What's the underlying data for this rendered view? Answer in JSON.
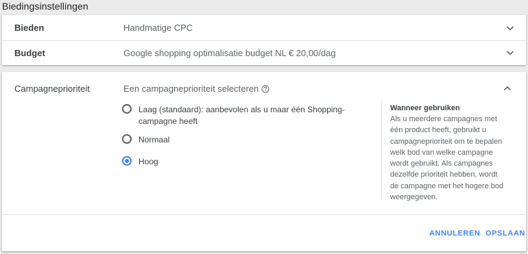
{
  "section_title": "Biedingsinstellingen",
  "rows": [
    {
      "label": "Bieden",
      "value": "Handmatige CPC",
      "icon": "chevron-down-icon"
    },
    {
      "label": "Budget",
      "value": "Google shopping optimalisatie budget NL € 20,00/dag",
      "icon": "chevron-down-icon"
    }
  ],
  "priority": {
    "label": "Campagneprioriteit",
    "prompt": "Een campagneprioriteit selecteren",
    "help_icon": "question-circle-icon",
    "collapse_icon": "chevron-up-icon",
    "options": [
      {
        "label": "Laag (standaard): aanbevolen als u maar één Shopping-campagne heeft",
        "selected": false
      },
      {
        "label": "Normaal",
        "selected": false
      },
      {
        "label": "Hoog",
        "selected": true
      }
    ],
    "help": {
      "title": "Wanneer gebruiken",
      "body": "Als u meerdere campagnes met één product heeft, gebruikt u campagneprioriteit om te bepalen welk bod van welke campagne wordt gebruikt. Als campagnes dezelfde prioriteit hebben, wordt de campagne met het hogere bod weergegeven."
    },
    "buttons": {
      "cancel": "ANNULEREN",
      "save": "OPSLAAN"
    }
  },
  "colors": {
    "accent": "#4285f4",
    "text": "#3c4043",
    "muted": "#5f6368",
    "background": "#ebebeb"
  }
}
